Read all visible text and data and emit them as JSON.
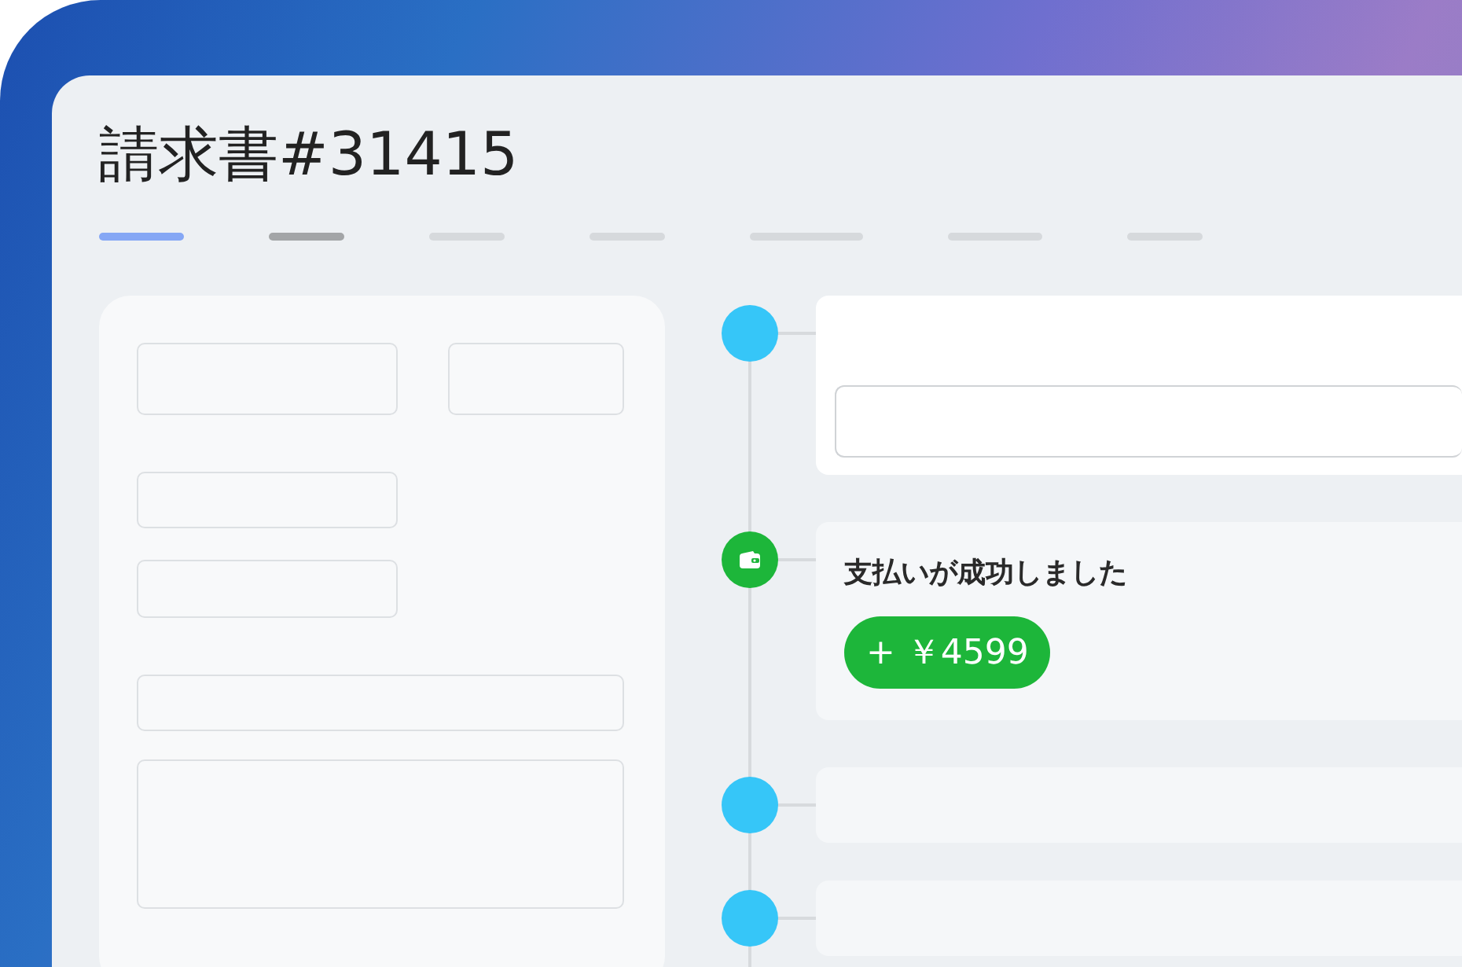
{
  "title": "請求書#31415",
  "tabs": [
    {
      "selected": true,
      "highlighted": false
    },
    {
      "selected": false,
      "highlighted": true
    },
    {
      "selected": false,
      "highlighted": false
    },
    {
      "selected": false,
      "highlighted": false
    },
    {
      "selected": false,
      "highlighted": false
    },
    {
      "selected": false,
      "highlighted": false
    },
    {
      "selected": false,
      "highlighted": false
    }
  ],
  "timeline": [
    {
      "kind": "field"
    },
    {
      "kind": "payment",
      "title": "支払いが成功しました",
      "amount": "+ ￥4599"
    },
    {
      "kind": "blank"
    },
    {
      "kind": "blank"
    }
  ]
}
